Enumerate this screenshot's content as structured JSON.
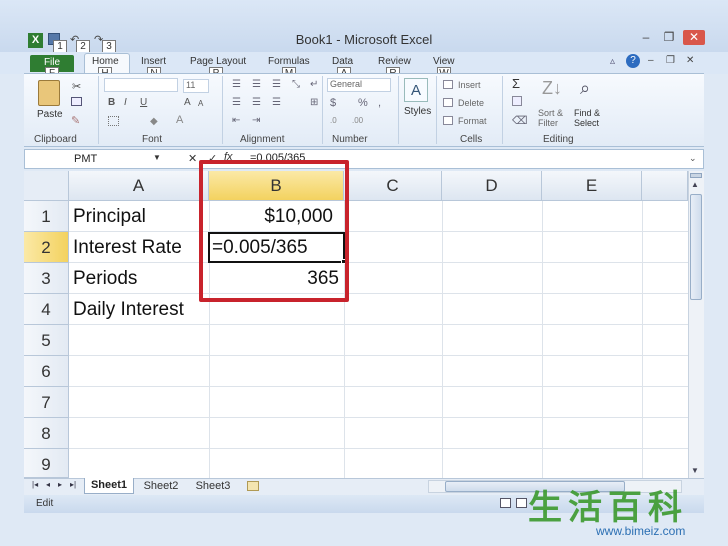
{
  "window": {
    "title": "Book1  -  Microsoft Excel",
    "min": "–",
    "restore": "❐",
    "close": "✕"
  },
  "quick_access": {
    "keytips": [
      "1",
      "2",
      "3"
    ],
    "app_icon": "X"
  },
  "tabs": [
    {
      "label": "File",
      "keytip": "F"
    },
    {
      "label": "Home",
      "keytip": "H"
    },
    {
      "label": "Insert",
      "keytip": "N"
    },
    {
      "label": "Page Layout",
      "keytip": "P"
    },
    {
      "label": "Formulas",
      "keytip": "M"
    },
    {
      "label": "Data",
      "keytip": "A"
    },
    {
      "label": "Review",
      "keytip": "R"
    },
    {
      "label": "View",
      "keytip": "W"
    }
  ],
  "ribbon": {
    "groups": {
      "clipboard": "Clipboard",
      "font": "Font",
      "alignment": "Alignment",
      "number": "Number",
      "cells": "Cells",
      "editing": "Editing"
    },
    "paste": "Paste",
    "font_size": "11",
    "number_format": "General",
    "styles": "Styles",
    "insert": "Insert",
    "delete": "Delete",
    "format": "Format",
    "sort_filter": "Sort & Filter",
    "find_select": "Find & Select"
  },
  "formula_bar": {
    "name_box": "PMT",
    "fx": "fx",
    "cancel": "✕",
    "enter": "✓",
    "formula": "=0.005/365"
  },
  "columns": [
    "A",
    "B",
    "C",
    "D",
    "E"
  ],
  "rows": [
    "1",
    "2",
    "3",
    "4",
    "5",
    "6",
    "7",
    "8",
    "9"
  ],
  "cells": {
    "A1": "Principal",
    "B1": "$10,000",
    "A2": "Interest Rate",
    "B2": "=0.005/365",
    "A3": "Periods",
    "B3": "365",
    "A4": "Daily Interest"
  },
  "sheets": [
    "Sheet1",
    "Sheet2",
    "Sheet3"
  ],
  "status": "Edit",
  "watermark": {
    "text": "生活百科",
    "url": "www.bimeiz.com"
  },
  "colors": {
    "accent": "#2f7d32",
    "highlight": "#c8232c",
    "selected_header": "#f7d863"
  }
}
